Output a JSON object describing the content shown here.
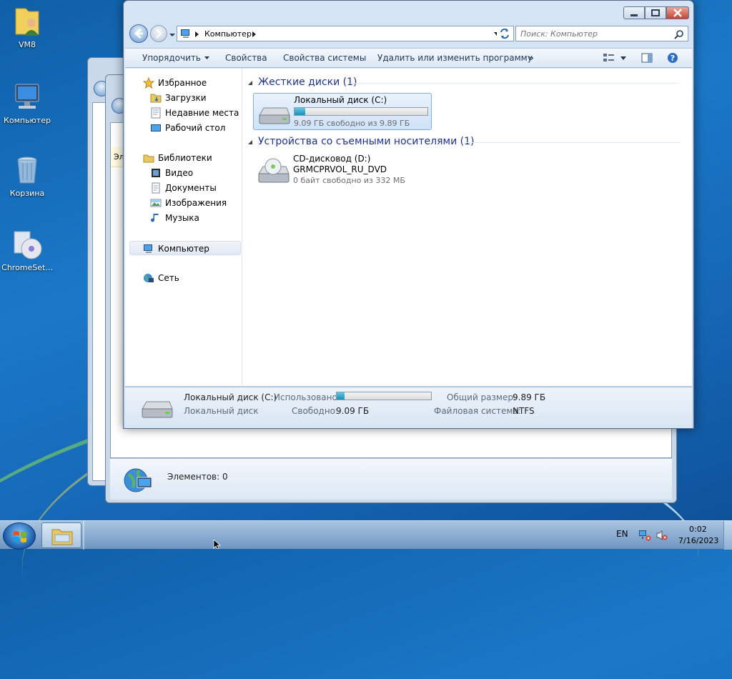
{
  "desktop": {
    "icons": [
      {
        "label": "VM8"
      },
      {
        "label": "Компьютер"
      },
      {
        "label": "Корзина"
      },
      {
        "label": "ChromeSet..."
      }
    ]
  },
  "bg_window": {
    "partial_text": "Эл",
    "status": "Элементов: 0"
  },
  "window": {
    "address": {
      "crumb": "Компьютер"
    },
    "search": {
      "placeholder": "Поиск: Компьютер"
    },
    "toolbar": {
      "organize": "Упорядочить",
      "properties": "Свойства",
      "system_properties": "Свойства системы",
      "uninstall": "Удалить или изменить программу",
      "more": "»"
    },
    "nav": {
      "favorites": "Избранное",
      "downloads": "Загрузки",
      "recent": "Недавние места",
      "desktop": "Рабочий стол",
      "libraries": "Библиотеки",
      "video": "Видео",
      "documents": "Документы",
      "pictures": "Изображения",
      "music": "Музыка",
      "computer": "Компьютер",
      "network": "Сеть"
    },
    "groups": {
      "hdd": "Жесткие диски (1)",
      "removable": "Устройства со съемными носителями (1)"
    },
    "drives": {
      "c": {
        "name": "Локальный диск (C:)",
        "free": "9.09 ГБ свободно из 9.89 ГБ",
        "used_fraction": 0.08
      },
      "d": {
        "name": "CD-дисковод (D:)",
        "label": "GRMCPRVOL_RU_DVD",
        "free": "0 байт свободно из 332 МБ"
      }
    },
    "details": {
      "name": "Локальный диск (C:)",
      "type": "Локальный диск",
      "used_label": "Использовано:",
      "free_label": "Свободно:",
      "free_value": "9.09 ГБ",
      "total_label": "Общий размер:",
      "total_value": "9.89 ГБ",
      "fs_label": "Файловая система:",
      "fs_value": "NTFS",
      "used_fraction": 0.08
    }
  },
  "taskbar": {
    "lang": "EN",
    "time": "0:02",
    "date": "7/16/2023"
  },
  "colors": {
    "accent": "#1e3287",
    "selection": "#cfe2f7",
    "bar_fill": "#1a8fb8"
  }
}
